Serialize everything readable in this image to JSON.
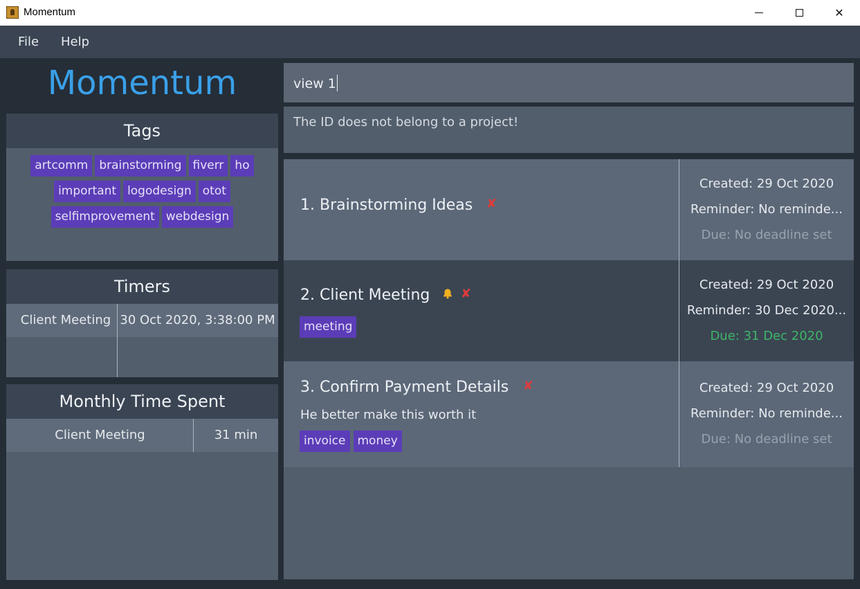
{
  "window": {
    "title": "Momentum",
    "controls": {
      "minimize": "minimize",
      "maximize": "maximize",
      "close": "✕"
    }
  },
  "menu": {
    "file": "File",
    "help": "Help"
  },
  "logo": "Momentum",
  "tags_panel": {
    "title": "Tags",
    "tags": [
      "artcomm",
      "brainstorming",
      "fiverr",
      "ho",
      "important",
      "logodesign",
      "otot",
      "selfimprovement",
      "webdesign"
    ]
  },
  "timers_panel": {
    "title": "Timers",
    "rows": [
      {
        "name": "Client Meeting",
        "started": "30 Oct 2020, 3:38:00 PM"
      }
    ]
  },
  "monthly_panel": {
    "title": "Monthly Time Spent",
    "rows": [
      {
        "name": "Client Meeting",
        "duration": "31 min"
      }
    ]
  },
  "command": {
    "value": "view 1"
  },
  "result": {
    "message": "The ID does not belong to a project!"
  },
  "projects": [
    {
      "title": "1. Brainstorming Ideas",
      "has_reminder_icon": false,
      "description": "",
      "tags": [],
      "created": "Created: 29 Oct 2020",
      "reminder": "Reminder: No reminde...",
      "due": "Due: No deadline set",
      "due_status": "none"
    },
    {
      "title": "2. Client Meeting",
      "has_reminder_icon": true,
      "description": "",
      "tags": [
        "meeting"
      ],
      "created": "Created: 29 Oct 2020",
      "reminder": "Reminder: 30 Dec 2020...",
      "due": "Due: 31 Dec 2020",
      "due_status": "upcoming"
    },
    {
      "title": "3. Confirm Payment Details",
      "has_reminder_icon": false,
      "description": "He better make this worth it",
      "tags": [
        "invoice",
        "money"
      ],
      "created": "Created: 29 Oct 2020",
      "reminder": "Reminder: No reminde...",
      "due": "Due: No deadline set",
      "due_status": "none"
    }
  ],
  "icons": {
    "incomplete": "cross-icon",
    "reminder": "bell-icon",
    "app": "app-icon"
  },
  "colors": {
    "accent": "#3aa0e8",
    "tag": "#5b3db8",
    "incomplete": "#e03c3c",
    "due_upcoming": "#3db568",
    "bell": "#f0b020"
  }
}
